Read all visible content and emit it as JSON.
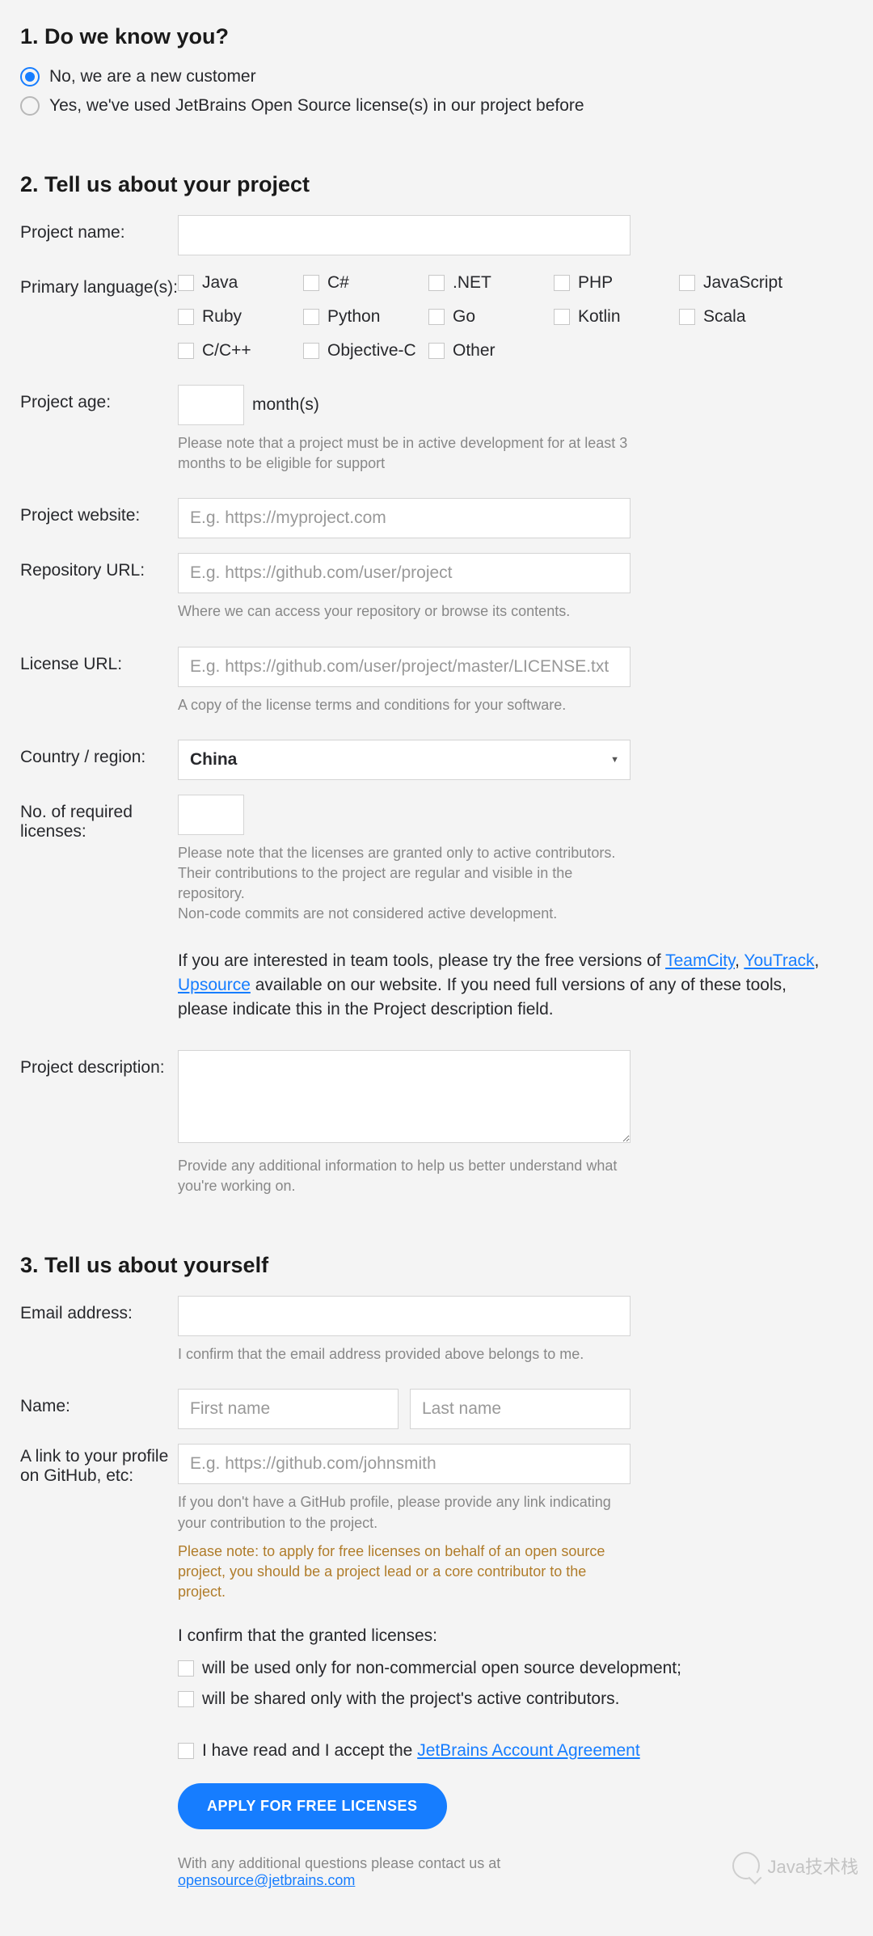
{
  "section1": {
    "title": "1.  Do we know you?",
    "radio_new": "No, we are a new customer",
    "radio_existing": "Yes, we've used JetBrains Open Source license(s) in our project before",
    "selected": "new"
  },
  "section2": {
    "title": "2. Tell us about your project",
    "project_name_label": "Project name:",
    "primary_lang_label": "Primary language(s):",
    "languages": [
      "Java",
      "C#",
      ".NET",
      "PHP",
      "JavaScript",
      "Ruby",
      "Python",
      "Go",
      "Kotlin",
      "Scala",
      "C/C++",
      "Objective-C",
      "Other"
    ],
    "project_age_label": "Project age:",
    "project_age_suffix": "month(s)",
    "project_age_hint": "Please note that a project must be in active development for at least 3 months to be eligible for support",
    "website_label": "Project website:",
    "website_placeholder": "E.g. https://myproject.com",
    "repo_label": "Repository URL:",
    "repo_placeholder": "E.g. https://github.com/user/project",
    "repo_hint": "Where we can access your repository or browse its contents.",
    "license_label": "License URL:",
    "license_placeholder": "E.g. https://github.com/user/project/master/LICENSE.txt",
    "license_hint": "A copy of the license terms and conditions for your software.",
    "country_label": "Country / region:",
    "country_value": "China",
    "num_licenses_label": "No. of required licenses:",
    "num_licenses_hint": "Please note that the licenses are granted only to active contributors.\nTheir contributions to the project are regular and visible in the repository.\nNon-code commits are not considered active development.",
    "tools_para_prefix": "If you are interested in team tools, please try the free versions of ",
    "tools_links": {
      "teamcity": "TeamCity",
      "youtrack": "YouTrack",
      "upsource": "Upsource"
    },
    "tools_para_suffix": " available on our website. If you need full versions of any of these tools, please indicate this in the Project description field.",
    "desc_label": "Project description:",
    "desc_hint": "Provide any additional information to help us better understand what you're working on."
  },
  "section3": {
    "title": "3. Tell us about yourself",
    "email_label": "Email address:",
    "email_hint": "I confirm that the email address provided above belongs to me.",
    "name_label": "Name:",
    "first_name_placeholder": "First name",
    "last_name_placeholder": "Last name",
    "profile_label": "A link to your profile on GitHub, etc:",
    "profile_placeholder": "E.g. https://github.com/johnsmith",
    "profile_hint": "If you don't have a GitHub profile, please provide any link indicating your contribution to the project.",
    "profile_note": "Please note: to apply for free licenses on behalf of an open source project, you should be a project lead or a core contributor to the project.",
    "confirm_heading": "I confirm that the granted licenses:",
    "confirm1": "will be used only for non-commercial open source development;",
    "confirm2": "will be shared only with the project's active contributors.",
    "accept_prefix": "I have read and I accept the ",
    "accept_link": "JetBrains Account Agreement",
    "apply_btn": "APPLY FOR FREE LICENSES",
    "footer_text": "With any additional questions please contact us at",
    "footer_email": "opensource@jetbrains.com"
  },
  "watermark": "Java技术栈"
}
